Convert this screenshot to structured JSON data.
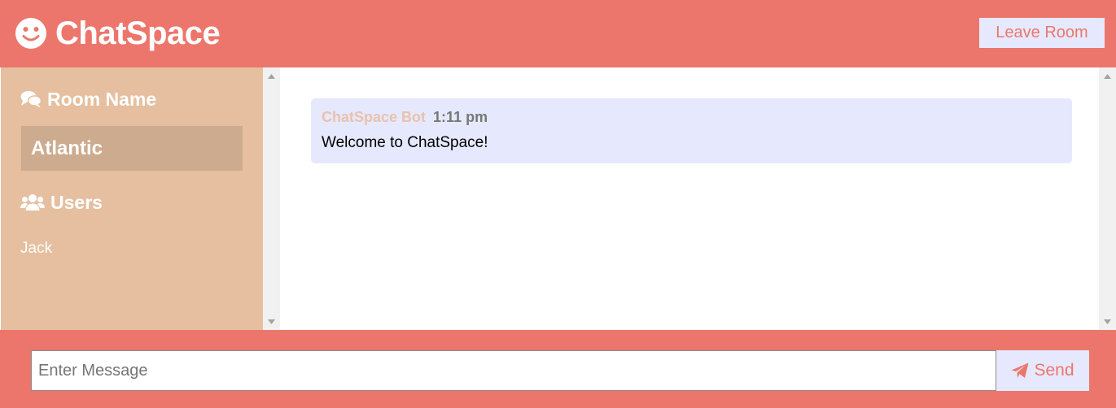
{
  "header": {
    "brand_icon": "smile-icon",
    "app_title": "ChatSpace",
    "leave_label": "Leave Room"
  },
  "sidebar": {
    "room_heading": "Room Name",
    "room_heading_icon": "comments-icon",
    "room_name": "Atlantic",
    "users_heading": "Users",
    "users_heading_icon": "users-icon",
    "users": [
      "Jack"
    ]
  },
  "messages": [
    {
      "author": "ChatSpace Bot",
      "time": "1:11 pm",
      "text": "Welcome to ChatSpace!"
    }
  ],
  "composer": {
    "placeholder": "Enter Message",
    "value": "",
    "send_label": "Send",
    "send_icon": "paper-plane-icon"
  },
  "colors": {
    "primary": "#ec766c",
    "sidebar": "#e5bf9f",
    "room_highlight": "#cdab8f",
    "light_accent": "#e6e9fd",
    "author": "#e9c1ad"
  }
}
